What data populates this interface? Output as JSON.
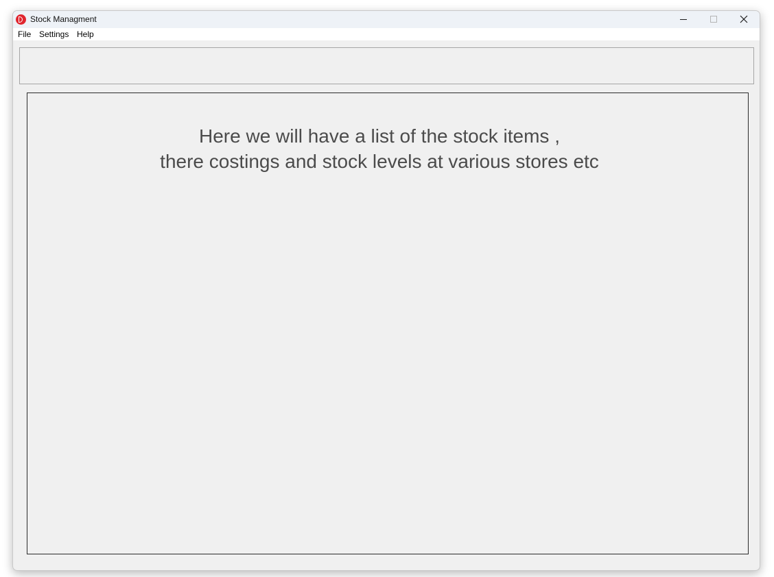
{
  "window": {
    "title": "Stock Managment",
    "icon": "app-logo-icon",
    "controls": [
      "minimize-icon",
      "maximize-icon",
      "close-icon"
    ]
  },
  "menu": {
    "items": [
      "File",
      "Settings",
      "Help"
    ]
  },
  "content": {
    "placeholder_line1": "Here we will have a list of the stock items ,",
    "placeholder_line2": "there costings and stock levels at various stores etc"
  },
  "colors": {
    "accent": "#e0262f",
    "window_bg": "#f0f0f0",
    "text": "#4b4b4b"
  }
}
